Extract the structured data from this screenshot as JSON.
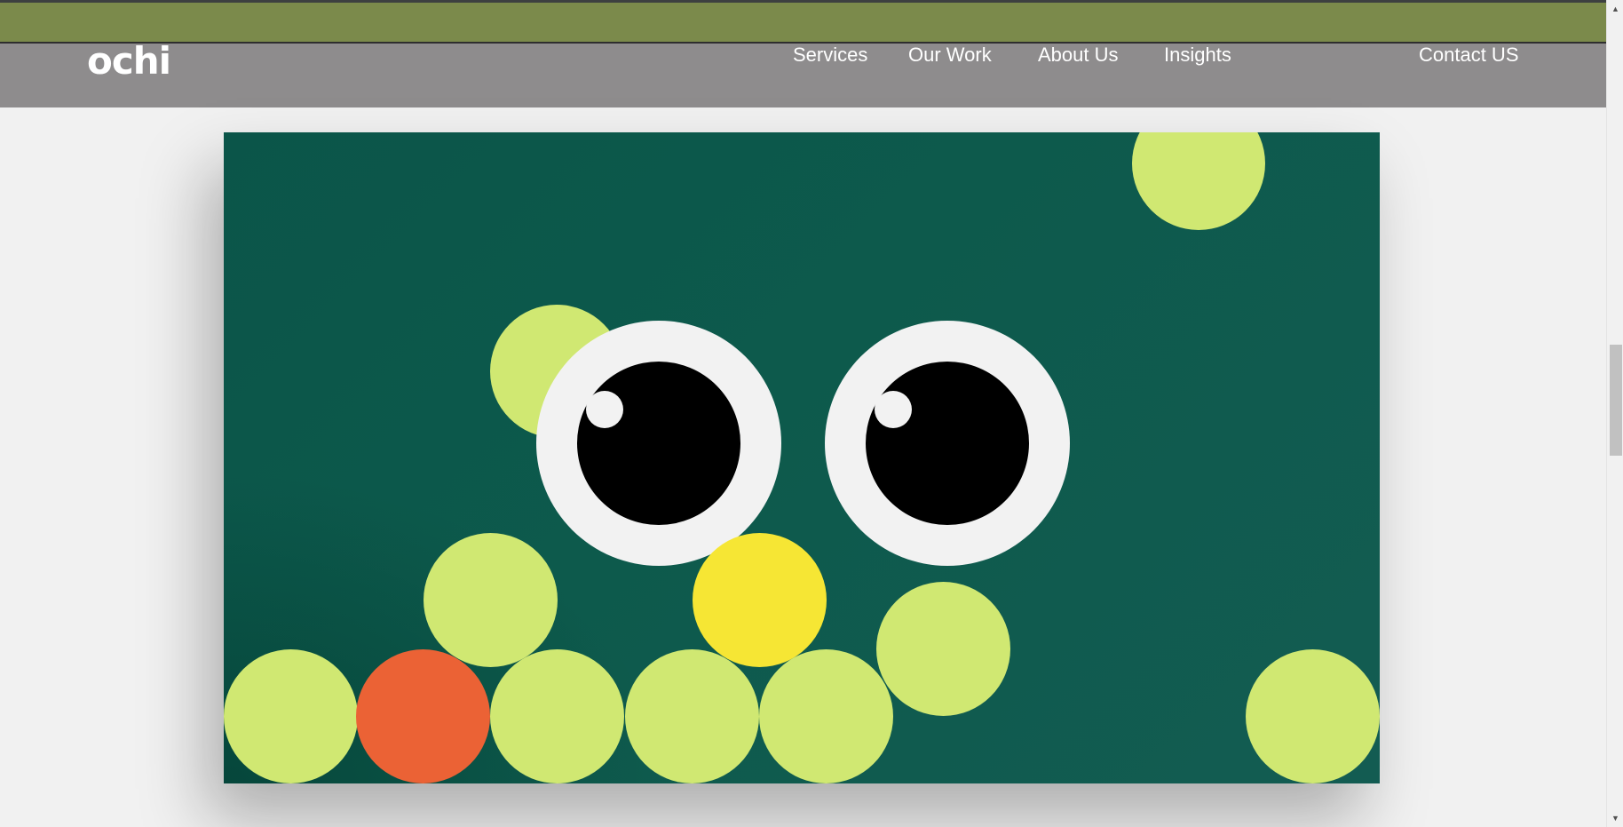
{
  "header": {
    "logo_text": "ochi",
    "nav": {
      "services": "Services",
      "our_work": "Our Work",
      "about_us": "About Us",
      "insights": "Insights",
      "contact": "Contact US"
    }
  },
  "colors": {
    "topbar": "#7b8a4b",
    "navbar": "#8e8c8d",
    "hero_background": "#0d5a4c",
    "ball_lime": "#d0e872",
    "ball_orange": "#eb6235",
    "ball_yellow": "#f6e634",
    "eye_white": "#f2f2f2",
    "pupil": "#000000"
  },
  "scrollbar": {
    "up_icon": "triangle-up-icon",
    "down_icon": "triangle-down-icon"
  }
}
